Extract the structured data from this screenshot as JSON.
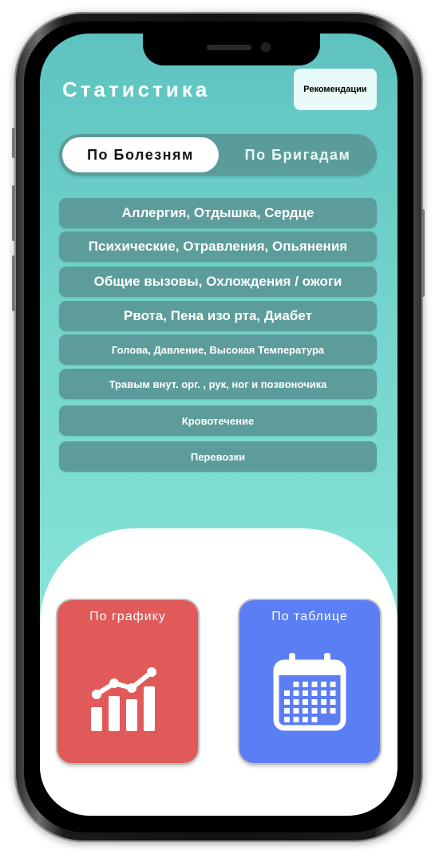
{
  "header": {
    "title": "Статистика",
    "recommend_label": "Рекомендации"
  },
  "tabs": {
    "active": "По Болезням",
    "inactive": "По Бригадам"
  },
  "diseases": [
    "Аллергия, Отдышка, Сердце",
    "Психические, Отравления, Опьянения",
    "Общие вызовы, Охлождения /  ожоги",
    "Рвота, Пена изо рта, Диабет",
    "Голова, Давление, Высокая Температура",
    "Травым внут. орг. , рук, ног и позвоночика",
    "Кровотечение",
    "Перевозки"
  ],
  "cards": {
    "chart_label": "По графику",
    "table_label": "По таблице"
  },
  "icons": {
    "chart": "bar-chart-icon",
    "table": "calendar-icon"
  },
  "colors": {
    "teal_bg": "#72d4cb",
    "list_item": "#5c9c9a",
    "chart_card": "#e05a5a",
    "table_card": "#5b7ef5"
  }
}
